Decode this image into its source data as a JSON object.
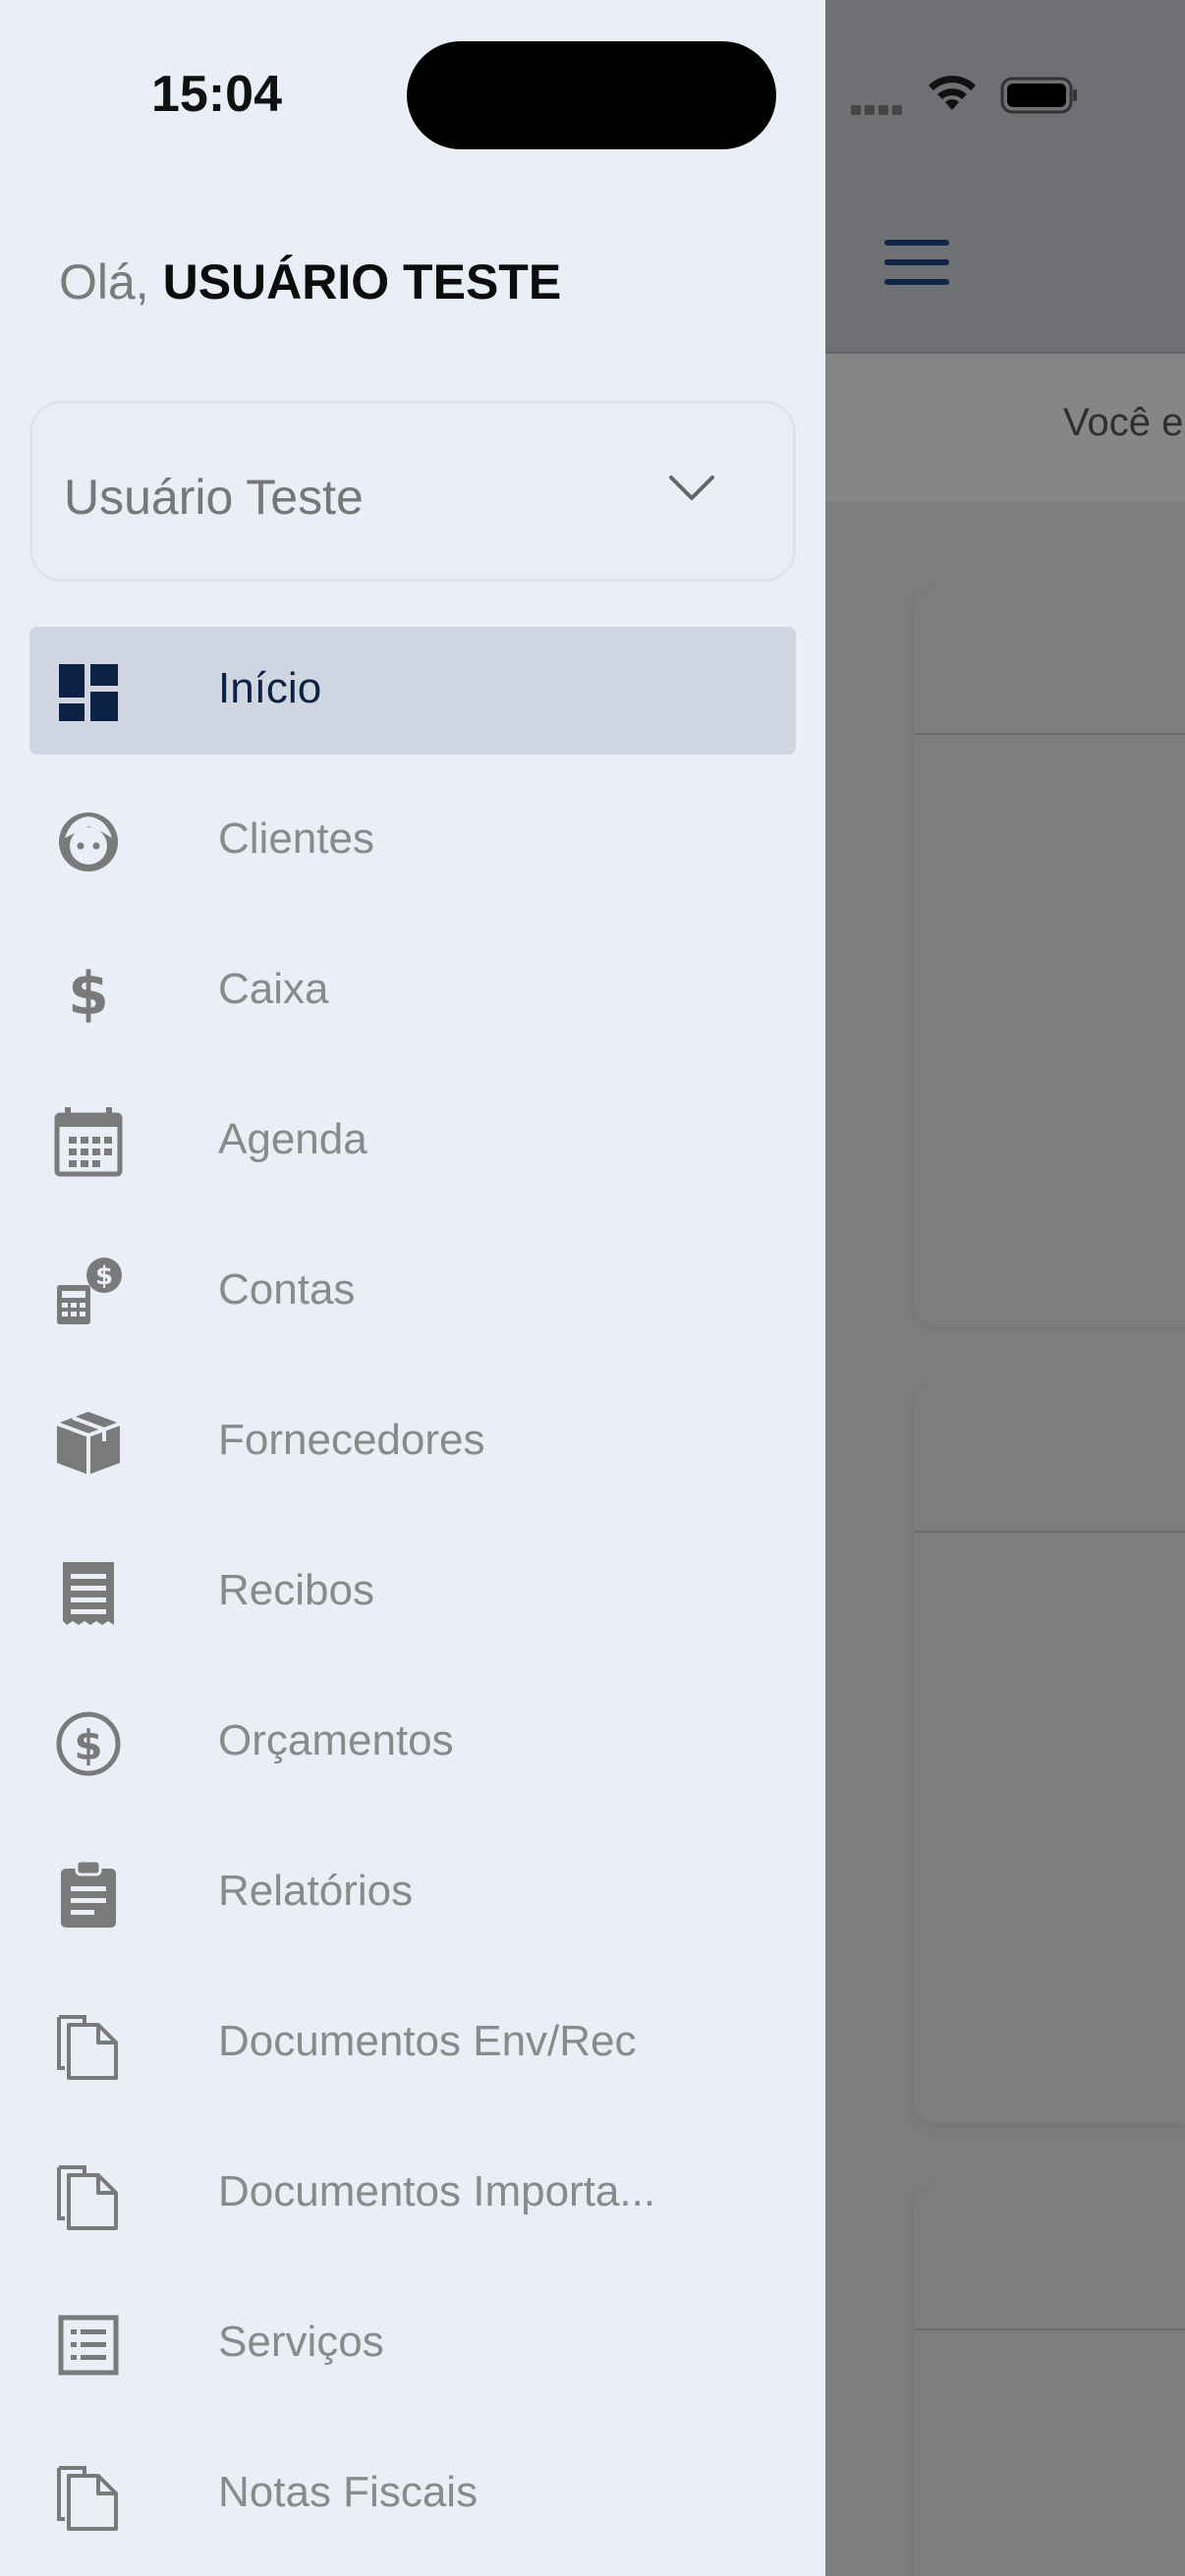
{
  "status_bar": {
    "time": "15:04"
  },
  "background_app": {
    "banner_text": "Você e"
  },
  "drawer": {
    "greeting_prefix": "Olá, ",
    "greeting_name": "USUÁRIO TESTE",
    "user_select": {
      "value": "Usuário Teste"
    },
    "menu": [
      {
        "label": "Início",
        "icon": "dashboard-icon",
        "active": true
      },
      {
        "label": "Clientes",
        "icon": "face-icon",
        "active": false
      },
      {
        "label": "Caixa",
        "icon": "dollar-icon",
        "active": false
      },
      {
        "label": "Agenda",
        "icon": "calendar-icon",
        "active": false
      },
      {
        "label": "Contas",
        "icon": "calculator-dollar-icon",
        "active": false
      },
      {
        "label": "Fornecedores",
        "icon": "box-icon",
        "active": false
      },
      {
        "label": "Recibos",
        "icon": "receipt-icon",
        "active": false
      },
      {
        "label": "Orçamentos",
        "icon": "circle-dollar-icon",
        "active": false
      },
      {
        "label": "Relatórios",
        "icon": "clipboard-icon",
        "active": false
      },
      {
        "label": "Documentos Env/Rec",
        "icon": "documents-icon",
        "active": false
      },
      {
        "label": "Documentos Importa...",
        "icon": "documents-icon",
        "active": false
      },
      {
        "label": "Serviços",
        "icon": "list-icon",
        "active": false
      },
      {
        "label": "Notas Fiscais",
        "icon": "documents-icon",
        "active": false
      }
    ]
  },
  "colors": {
    "drawer_bg": "#e9eef7",
    "active_bg": "#cfd6e2",
    "active_fg": "#0b2244",
    "inactive_fg": "#8a8a8a"
  }
}
